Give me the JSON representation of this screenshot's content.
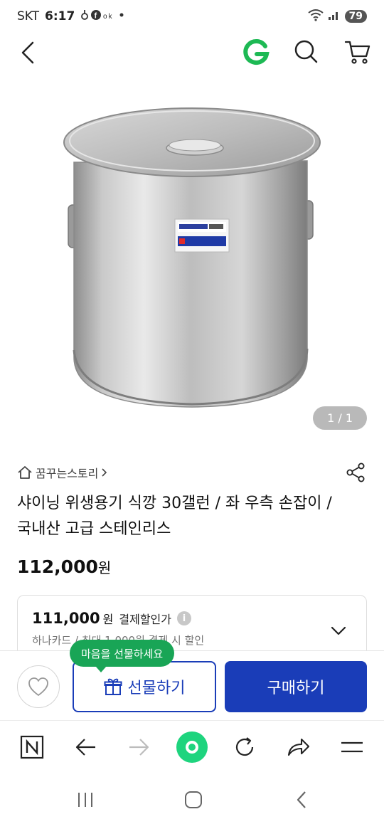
{
  "status_bar": {
    "carrier": "SKT",
    "time": "6:17",
    "battery": "79"
  },
  "nav": {
    "logo_letter": "G",
    "logo_color": "#1db954"
  },
  "image": {
    "counter": "1 / 1"
  },
  "product": {
    "store_name": "꿈꾸는스토리",
    "title": "샤이닝 위생용기 식깡 30갤런 / 좌 우측 손잡이 / 국내산 고급 스테인리스",
    "price_value": "112,000",
    "price_unit": "원"
  },
  "discount": {
    "price_value": "111,000",
    "price_unit": "원",
    "label": "결제할인가",
    "info_glyph": "i",
    "note": "하나카드 / 최대 1,000원 결제 시 할인"
  },
  "purchase": {
    "tooltip": "마음을 선물하세요",
    "gift_label": "선물하기",
    "buy_label": "구매하기",
    "accent": "#1a3db8",
    "tooltip_color": "#19a556"
  }
}
